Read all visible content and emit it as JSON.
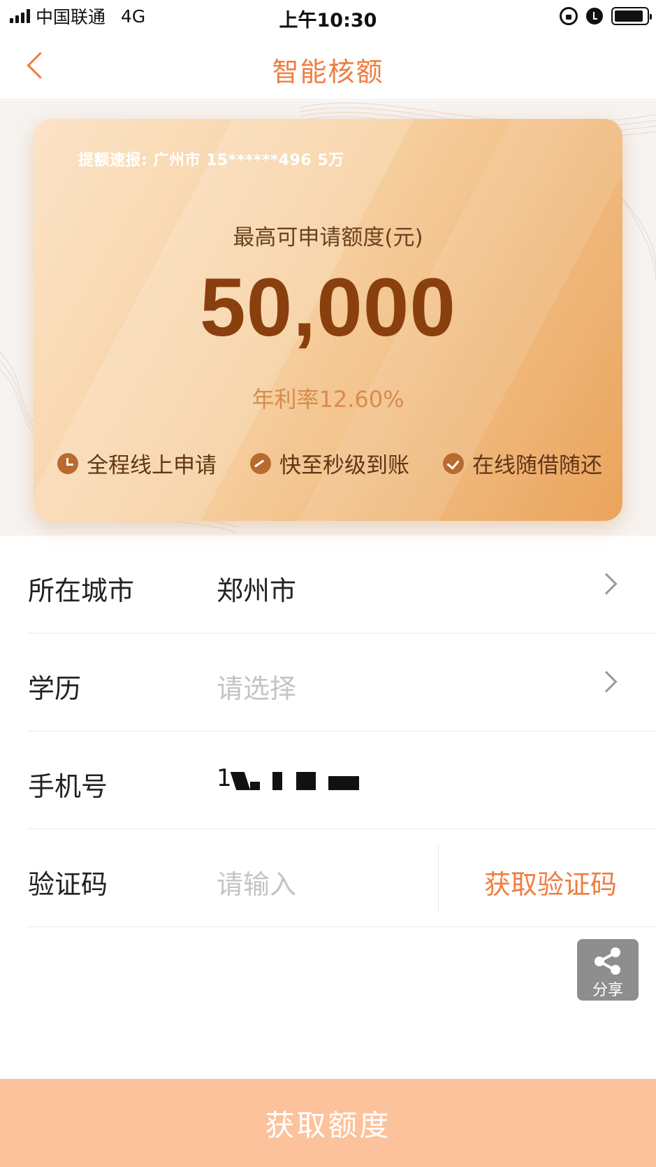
{
  "status_bar": {
    "carrier": "中国联通",
    "network": "4G",
    "time": "上午10:30",
    "battery_level": 0.9
  },
  "nav": {
    "title": "智能核额",
    "back_icon": "chevron-left-icon"
  },
  "hero": {
    "ticker": "提额速报: 广州市 15******496 5万",
    "limit_label": "最高可申请额度(元)",
    "limit_amount": "50,000",
    "rate": "年利率12.60%",
    "features": [
      {
        "label": "全程线上申请",
        "icon": "clock-icon"
      },
      {
        "label": "快至秒级到账",
        "icon": "speed-icon"
      },
      {
        "label": "在线随借随还",
        "icon": "check-icon"
      }
    ]
  },
  "form": {
    "city": {
      "label": "所在城市",
      "value": "郑州市"
    },
    "education": {
      "label": "学历",
      "placeholder": "请选择"
    },
    "phone": {
      "label": "手机号",
      "value_visible_prefix": "1"
    },
    "code": {
      "label": "验证码",
      "placeholder": "请输入",
      "get_code_label": "获取验证码"
    }
  },
  "share": {
    "label": "分享",
    "icon": "share-icon"
  },
  "cta": {
    "label": "获取额度"
  },
  "colors": {
    "accent": "#f07d3f",
    "cta_bg": "#fcc29b",
    "amount": "#8a3f0e",
    "ticker_bg": "#ff6a3d"
  }
}
